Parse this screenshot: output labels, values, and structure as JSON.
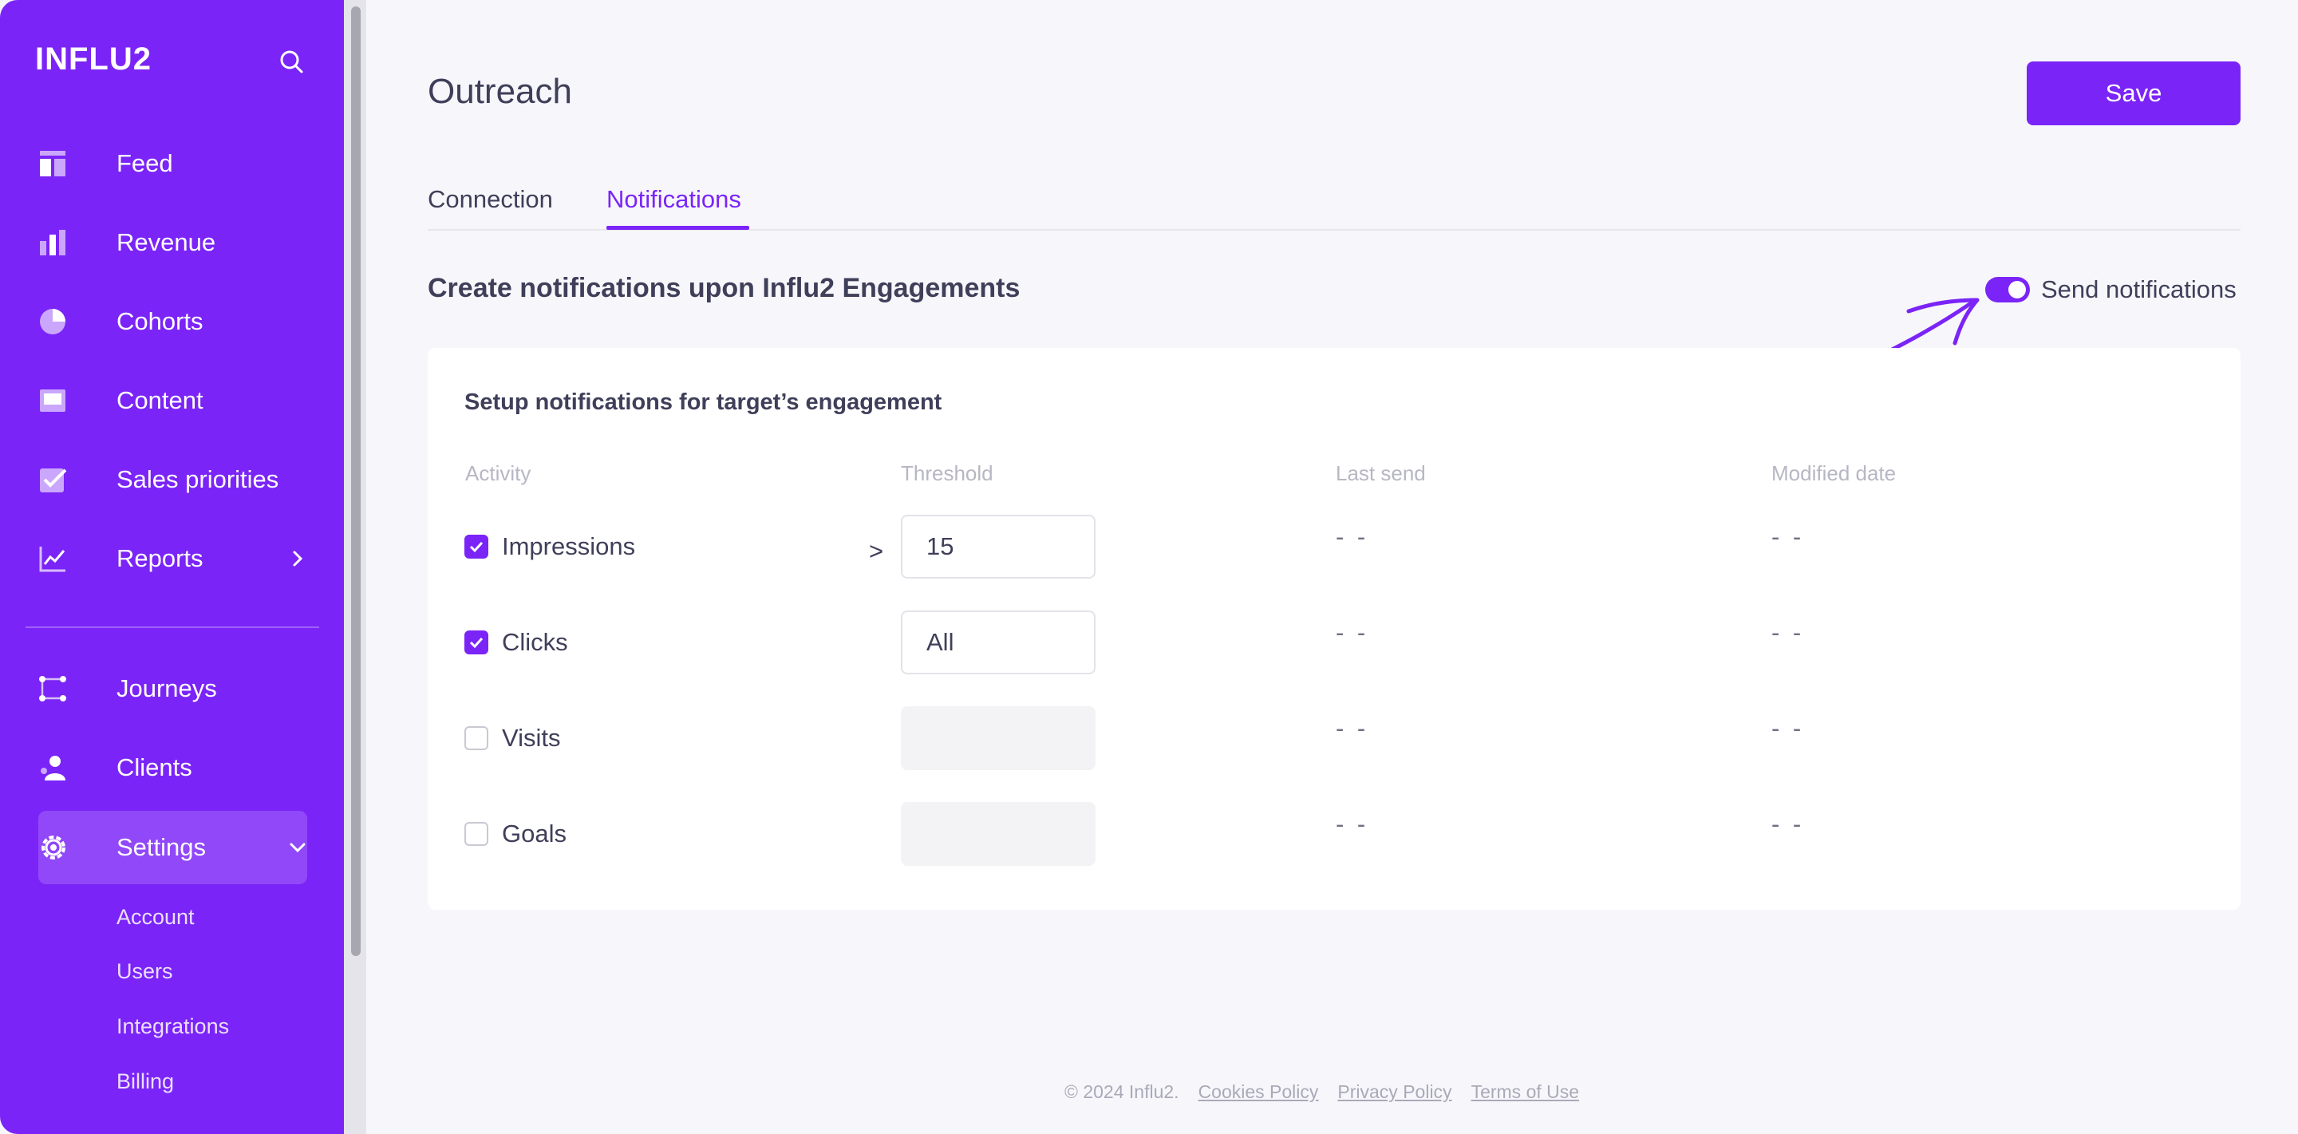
{
  "sidebar": {
    "logo": "INFLU2",
    "items": [
      {
        "label": "Feed",
        "icon": "feed-icon"
      },
      {
        "label": "Revenue",
        "icon": "bar-chart-icon"
      },
      {
        "label": "Cohorts",
        "icon": "pie-chart-icon"
      },
      {
        "label": "Content",
        "icon": "content-icon"
      },
      {
        "label": "Sales priorities",
        "icon": "checkbox-icon"
      },
      {
        "label": "Reports",
        "icon": "line-chart-icon"
      },
      {
        "label": "Journeys",
        "icon": "journeys-icon"
      },
      {
        "label": "Clients",
        "icon": "clients-icon"
      },
      {
        "label": "Settings",
        "icon": "gear-icon"
      }
    ],
    "settings_sub": [
      "Account",
      "Users",
      "Integrations",
      "Billing"
    ],
    "colors": {
      "bg": "#7b24f7"
    }
  },
  "main": {
    "title": "Outreach",
    "save_label": "Save",
    "tabs": [
      {
        "label": "Connection",
        "active": false
      },
      {
        "label": "Notifications",
        "active": true
      }
    ],
    "section_title": "Create notifications upon Influ2 Engagements",
    "toggle_label": "Send notifications",
    "toggle_on": true,
    "card": {
      "title": "Setup notifications for target’s engagement",
      "columns": [
        "Activity",
        "Threshold",
        "Last send",
        "Modified date"
      ],
      "rows": [
        {
          "activity": "Impressions",
          "checked": true,
          "operator": ">",
          "threshold": "15",
          "last_send": "- -",
          "modified": "- -"
        },
        {
          "activity": "Clicks",
          "checked": true,
          "operator": "",
          "threshold": "All",
          "last_send": "- -",
          "modified": "- -"
        },
        {
          "activity": "Visits",
          "checked": false,
          "operator": "",
          "threshold": "",
          "last_send": "- -",
          "modified": "- -"
        },
        {
          "activity": "Goals",
          "checked": false,
          "operator": "",
          "threshold": "",
          "last_send": "- -",
          "modified": "- -"
        }
      ]
    }
  },
  "footer": {
    "copyright": "© 2024 Influ2.",
    "links": [
      "Cookies Policy",
      "Privacy Policy",
      "Terms of Use"
    ]
  }
}
